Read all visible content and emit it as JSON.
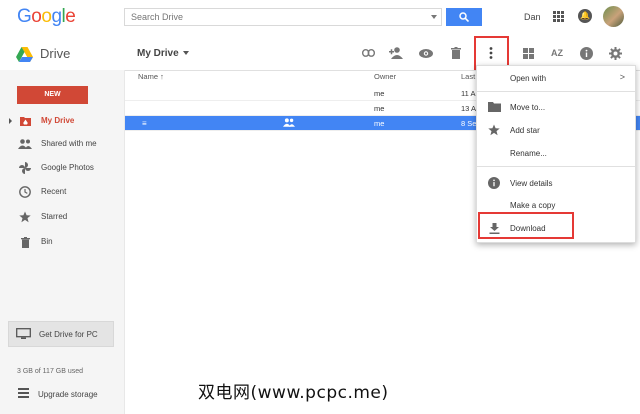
{
  "header": {
    "logo": [
      "G",
      "o",
      "o",
      "g",
      "l",
      "e"
    ],
    "search_placeholder": "Search Drive",
    "user_name": "Dan"
  },
  "drivebar": {
    "app_title": "Drive",
    "location": "My Drive"
  },
  "sidebar": {
    "new_label": "NEW",
    "items": [
      {
        "label": "My Drive",
        "icon": "my-drive-icon",
        "active": true
      },
      {
        "label": "Shared with me",
        "icon": "shared-icon"
      },
      {
        "label": "Google Photos",
        "icon": "photos-icon"
      },
      {
        "label": "Recent",
        "icon": "clock-icon"
      },
      {
        "label": "Starred",
        "icon": "star-icon"
      },
      {
        "label": "Bin",
        "icon": "trash-icon"
      }
    ],
    "get_drive": "Get Drive for PC",
    "storage": "3 GB of 117 GB used",
    "upgrade": "Upgrade storage"
  },
  "filelist": {
    "headers": {
      "name": "Name ↑",
      "owner": "Owner",
      "last": "Last"
    },
    "rows": [
      {
        "owner": "me",
        "last": "11 A"
      },
      {
        "owner": "me",
        "last": "13 A"
      },
      {
        "owner": "me",
        "last": "8 Se",
        "selected": true
      }
    ]
  },
  "menu": {
    "items": [
      {
        "label": "Open with",
        "submenu": ">"
      },
      {
        "label": "Move to...",
        "icon": "folder-icon"
      },
      {
        "label": "Add star",
        "icon": "star-icon"
      },
      {
        "label": "Rename..."
      },
      {
        "label": "View details",
        "icon": "info-icon"
      },
      {
        "label": "Make a copy"
      },
      {
        "label": "Download",
        "icon": "download-icon"
      }
    ]
  },
  "watermark": "双电网(www.pcpc.me)",
  "colors": {
    "accent": "#4285f4",
    "new_button": "#d14836",
    "highlight_box": "#e53935"
  }
}
